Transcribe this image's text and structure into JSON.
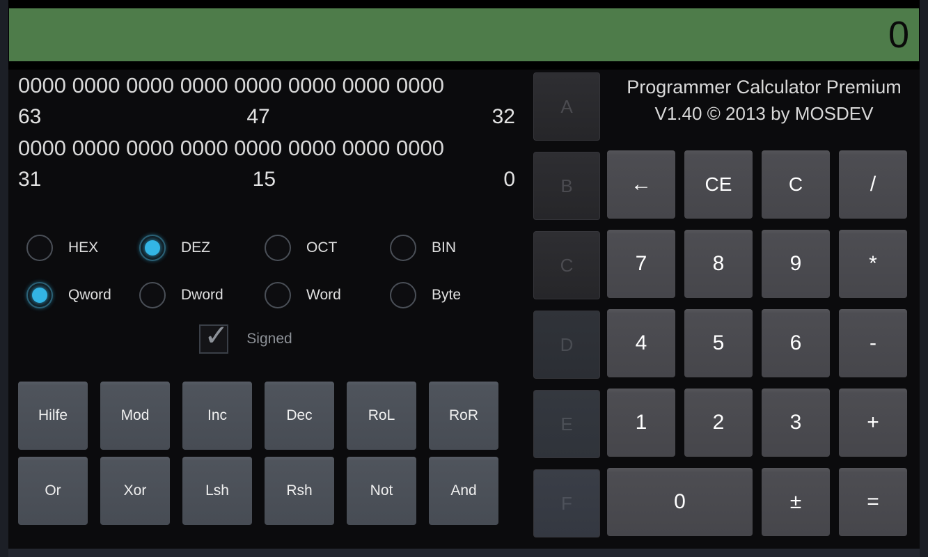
{
  "app": {
    "title_main": "Programmer Calculator Premium",
    "title_sub": "V1.40 © 2013 by MOSDEV",
    "accent_color": "#33b5e5",
    "display_bg": "#4e7c4a",
    "button_color": "#4a4f57"
  },
  "display": {
    "value": "0"
  },
  "bits": {
    "row_high": "0000 0000 0000 0000 0000 0000 0000 0000",
    "row_high_labels": {
      "left": "63",
      "center": "47",
      "right": "32"
    },
    "row_low": "0000 0000 0000 0000 0000 0000 0000 0000",
    "row_low_labels": {
      "left": "31",
      "center": "15",
      "right": "0"
    }
  },
  "base_modes": [
    {
      "label": "HEX",
      "selected": false
    },
    {
      "label": "DEZ",
      "selected": true
    },
    {
      "label": "OCT",
      "selected": false
    },
    {
      "label": "BIN",
      "selected": false
    }
  ],
  "word_sizes": [
    {
      "label": "Qword",
      "selected": true
    },
    {
      "label": "Dword",
      "selected": false
    },
    {
      "label": "Word",
      "selected": false
    },
    {
      "label": "Byte",
      "selected": false
    }
  ],
  "signed": {
    "label": "Signed",
    "checked": true,
    "tick_icon": "check-icon"
  },
  "function_buttons": {
    "row1": [
      "Hilfe",
      "Mod",
      "Inc",
      "Dec",
      "RoL",
      "RoR"
    ],
    "row2": [
      "Or",
      "Xor",
      "Lsh",
      "Rsh",
      "Not",
      "And"
    ]
  },
  "hex_buttons": [
    {
      "label": "A",
      "enabled": false
    },
    {
      "label": "B",
      "enabled": false
    },
    {
      "label": "C",
      "enabled": false
    },
    {
      "label": "D",
      "enabled": false
    },
    {
      "label": "E",
      "enabled": false
    },
    {
      "label": "F",
      "enabled": false
    }
  ],
  "keypad": {
    "row1": [
      "←",
      "CE",
      "C",
      "/"
    ],
    "row2": [
      "7",
      "8",
      "9",
      "*"
    ],
    "row3": [
      "4",
      "5",
      "6",
      "-"
    ],
    "row4": [
      "1",
      "2",
      "3",
      "+"
    ],
    "row5": [
      "0",
      "±",
      "="
    ]
  }
}
